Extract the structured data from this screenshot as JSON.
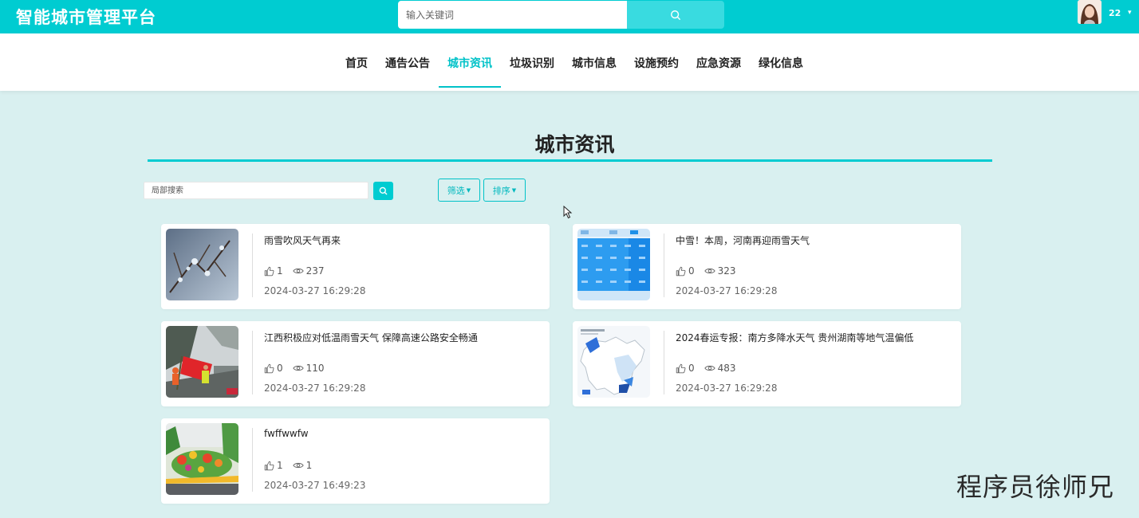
{
  "header": {
    "brand": "智能城市管理平台",
    "search_placeholder": "输入关键词",
    "username": "22"
  },
  "nav": {
    "items": [
      {
        "label": "首页",
        "active": false
      },
      {
        "label": "通告公告",
        "active": false
      },
      {
        "label": "城市资讯",
        "active": true
      },
      {
        "label": "垃圾识别",
        "active": false
      },
      {
        "label": "城市信息",
        "active": false
      },
      {
        "label": "设施预约",
        "active": false
      },
      {
        "label": "应急资源",
        "active": false
      },
      {
        "label": "绿化信息",
        "active": false
      }
    ]
  },
  "section": {
    "title": "城市资讯"
  },
  "filters": {
    "search_placeholder": "局部搜索",
    "filter_label": "筛选",
    "sort_label": "排序"
  },
  "articles": [
    {
      "title": "雨雪吹风天气再来",
      "likes": "1",
      "views": "237",
      "date": "2024-03-27 16:29:28"
    },
    {
      "title": "中雪！本周，河南再迎雨雪天气",
      "likes": "0",
      "views": "323",
      "date": "2024-03-27 16:29:28"
    },
    {
      "title": "江西积极应对低温雨雪天气 保障高速公路安全畅通",
      "likes": "0",
      "views": "110",
      "date": "2024-03-27 16:29:28"
    },
    {
      "title": "2024春运专报：南方多降水天气 贵州湖南等地气温偏低",
      "likes": "0",
      "views": "483",
      "date": "2024-03-27 16:29:28"
    },
    {
      "title": "fwffwwfw",
      "likes": "1",
      "views": "1",
      "date": "2024-03-27 16:49:23"
    }
  ],
  "watermark": "程序员徐师兄",
  "colors": {
    "primary": "#00ccd1",
    "background": "#d9f0f0",
    "active_nav": "#00c2c8"
  }
}
